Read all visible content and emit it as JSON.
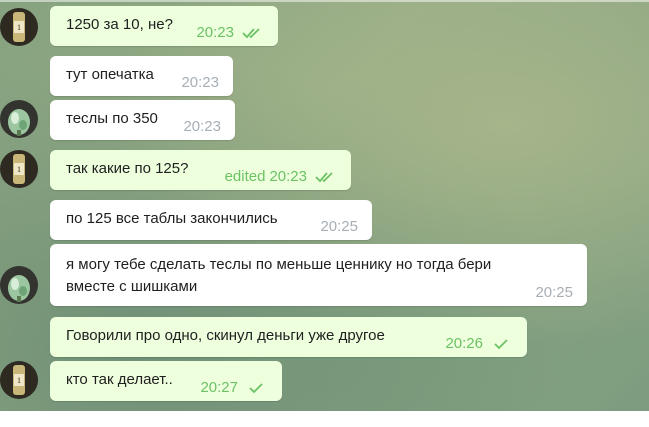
{
  "messages": [
    {
      "text": "1250 за 10, не?",
      "time": "20:23",
      "edited": "",
      "status": "read",
      "dir": "out"
    },
    {
      "text": "тут опечатка",
      "time": "20:23",
      "dir": "in"
    },
    {
      "text": "теслы по 350",
      "time": "20:23",
      "dir": "in"
    },
    {
      "text": "так какие по 125?",
      "time": "20:23",
      "edited": "edited",
      "status": "read",
      "dir": "out"
    },
    {
      "text": "по 125 все таблы закончились",
      "time": "20:25",
      "dir": "in"
    },
    {
      "text_lines": [
        "я могу тебе сделать теслы по меньше ценнику но тогда бери",
        "вместе с шишками"
      ],
      "time": "20:25",
      "dir": "in"
    },
    {
      "text": "Говорили про одно, скинул деньги уже другое",
      "time": "20:26",
      "status": "sent",
      "dir": "out"
    },
    {
      "text": "кто так делает..",
      "time": "20:27",
      "status": "sent",
      "dir": "out"
    }
  ],
  "avatars": [
    {
      "kind": "bottle-avatar"
    },
    {
      "kind": "plant-avatar"
    },
    {
      "kind": "bottle-avatar"
    },
    {
      "kind": "plant-avatar"
    },
    {
      "kind": "bottle-avatar"
    }
  ],
  "colors": {
    "incoming_bubble": "#ffffff",
    "outgoing_bubble": "#eeffde",
    "outgoing_meta": "#6cc264",
    "incoming_meta": "#a7afb6"
  }
}
